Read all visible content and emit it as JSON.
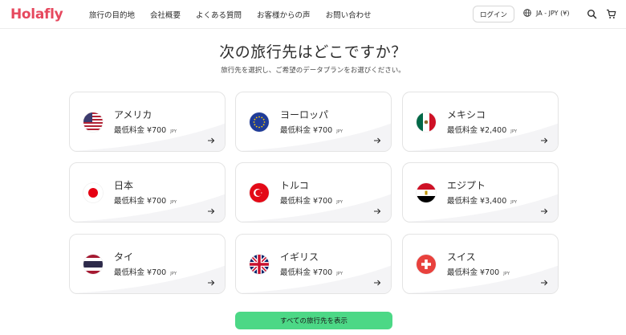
{
  "brand": {
    "name": "Holafly",
    "color": "#e6485e"
  },
  "nav": {
    "items": [
      {
        "label": "旅行の目的地"
      },
      {
        "label": "会社概要"
      },
      {
        "label": "よくある質問"
      },
      {
        "label": "お客様からの声"
      },
      {
        "label": "お問い合わせ"
      }
    ]
  },
  "header": {
    "login_label": "ログイン",
    "language_label": "JA - JPY (¥)",
    "icons": [
      "globe-icon",
      "search-icon",
      "cart-icon"
    ]
  },
  "hero": {
    "title": "次の旅行先はどこですか？",
    "subtitle": "旅行先を選択し、ご希望のデータプランをお選びください。"
  },
  "destinations": [
    {
      "name": "アメリカ",
      "price": "最低料金 ¥700",
      "currency": "JPY",
      "flag": "usa-flag-icon"
    },
    {
      "name": "ヨーロッパ",
      "price": "最低料金 ¥700",
      "currency": "JPY",
      "flag": "eu-flag-icon"
    },
    {
      "name": "メキシコ",
      "price": "最低料金 ¥2,400",
      "currency": "JPY",
      "flag": "mexico-flag-icon"
    },
    {
      "name": "日本",
      "price": "最低料金 ¥700",
      "currency": "JPY",
      "flag": "japan-flag-icon"
    },
    {
      "name": "トルコ",
      "price": "最低料金 ¥700",
      "currency": "JPY",
      "flag": "turkey-flag-icon"
    },
    {
      "name": "エジプト",
      "price": "最低料金 ¥3,400",
      "currency": "JPY",
      "flag": "egypt-flag-icon"
    },
    {
      "name": "タイ",
      "price": "最低料金 ¥700",
      "currency": "JPY",
      "flag": "thailand-flag-icon"
    },
    {
      "name": "イギリス",
      "price": "最低料金 ¥700",
      "currency": "JPY",
      "flag": "uk-flag-icon"
    },
    {
      "name": "スイス",
      "price": "最低料金 ¥700",
      "currency": "JPY",
      "flag": "switzerland-flag-icon"
    }
  ],
  "cta": {
    "label": "すべての旅行先を表示",
    "color": "#4cd886"
  }
}
